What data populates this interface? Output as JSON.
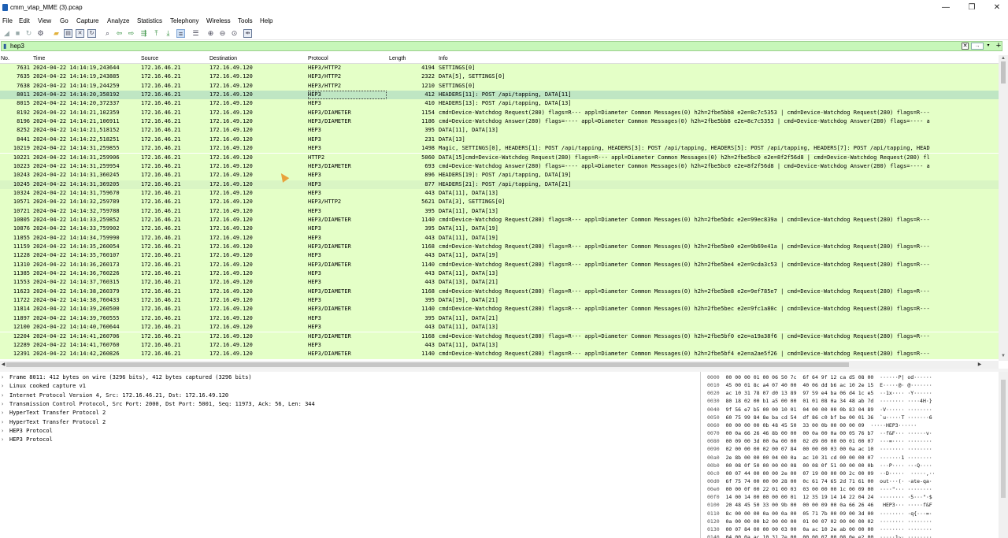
{
  "window": {
    "title": "cmm_vtap_MME (3).pcap",
    "minimize_label": "—",
    "maximize_label": "❐",
    "close_label": "✕"
  },
  "menu": [
    "File",
    "Edit",
    "View",
    "Go",
    "Capture",
    "Analyze",
    "Statistics",
    "Telephony",
    "Wireless",
    "Tools",
    "Help"
  ],
  "filter": {
    "value": "hep3",
    "clear_icon": "✕",
    "apply_icon": "→",
    "dropdown_icon": "▾",
    "add_icon": "+"
  },
  "columns": {
    "no": "No.",
    "time": "Time",
    "source": "Source",
    "destination": "Destination",
    "protocol": "Protocol",
    "length": "Length",
    "info": "Info"
  },
  "packets": [
    {
      "no": "7631",
      "time": "2024-04-22 14:14:19,243644",
      "src": "172.16.46.21",
      "dst": "172.16.49.120",
      "proto": "HEP3/HTTP2",
      "len": "4194",
      "info": "SETTINGS[0]"
    },
    {
      "no": "7635",
      "time": "2024-04-22 14:14:19,243885",
      "src": "172.16.46.21",
      "dst": "172.16.49.120",
      "proto": "HEP3/HTTP2",
      "len": "2322",
      "info": "DATA[5], SETTINGS[0]"
    },
    {
      "no": "7638",
      "time": "2024-04-22 14:14:19,244259",
      "src": "172.16.46.21",
      "dst": "172.16.49.120",
      "proto": "HEP3/HTTP2",
      "len": "1210",
      "info": "SETTINGS[0]"
    },
    {
      "no": "8011",
      "time": "2024-04-22 14:14:20,358192",
      "src": "172.16.46.21",
      "dst": "172.16.49.120",
      "proto": "HEP3",
      "len": "412",
      "info": "HEADERS[11]: POST /api/tapping, DATA[11]"
    },
    {
      "no": "8015",
      "time": "2024-04-22 14:14:20,372337",
      "src": "172.16.46.21",
      "dst": "172.16.49.120",
      "proto": "HEP3",
      "len": "410",
      "info": "HEADERS[13]: POST /api/tapping, DATA[13]"
    },
    {
      "no": "8192",
      "time": "2024-04-22 14:14:21,102359",
      "src": "172.16.46.21",
      "dst": "172.16.49.120",
      "proto": "HEP3/DIAMETER",
      "len": "1154",
      "info": "cmd=Device-Watchdog Request(280) flags=R--- appl=Diameter Common Messages(0) h2h=2fbe5bb8 e2e=8c7c5353 | cmd=Device-Watchdog Request(280) flags=R---"
    },
    {
      "no": "8196",
      "time": "2024-04-22 14:14:21,106911",
      "src": "172.16.46.21",
      "dst": "172.16.49.120",
      "proto": "HEP3/DIAMETER",
      "len": "1186",
      "info": "cmd=Device-Watchdog Answer(280) flags=---- appl=Diameter Common Messages(0) h2h=2fbe5bb8 e2e=8c7c5353 | cmd=Device-Watchdog Answer(280) flags=---- a"
    },
    {
      "no": "8252",
      "time": "2024-04-22 14:14:21,518152",
      "src": "172.16.46.21",
      "dst": "172.16.49.120",
      "proto": "HEP3",
      "len": "395",
      "info": "DATA[11], DATA[13]"
    },
    {
      "no": "8441",
      "time": "2024-04-22 14:14:22,518251",
      "src": "172.16.46.21",
      "dst": "172.16.49.120",
      "proto": "HEP3",
      "len": "231",
      "info": "DATA[13]"
    },
    {
      "no": "10219",
      "time": "2024-04-22 14:14:31,259855",
      "src": "172.16.46.21",
      "dst": "172.16.49.120",
      "proto": "HEP3",
      "len": "1498",
      "info": "Magic, SETTINGS[0], HEADERS[1]: POST /api/tapping, HEADERS[3]: POST /api/tapping, HEADERS[5]: POST /api/tapping, HEADERS[7]: POST /api/tapping, HEAD"
    },
    {
      "no": "10221",
      "time": "2024-04-22 14:14:31,259906",
      "src": "172.16.46.21",
      "dst": "172.16.49.120",
      "proto": "HTTP2",
      "len": "5060",
      "info": "DATA[15]cmd=Device-Watchdog Request(280) flags=R--- appl=Diameter Common Messages(0) h2h=2fbe5bc0 e2e=8f2f56d8 | cmd=Device-Watchdog Request(280) fl"
    },
    {
      "no": "10223",
      "time": "2024-04-22 14:14:31,259954",
      "src": "172.16.46.21",
      "dst": "172.16.49.120",
      "proto": "HEP3/DIAMETER",
      "len": "693",
      "info": "cmd=Device-Watchdog Answer(280) flags=---- appl=Diameter Common Messages(0) h2h=2fbe5bc0 e2e=8f2f56d8 | cmd=Device-Watchdog Answer(280) flags=---- a"
    },
    {
      "no": "10243",
      "time": "2024-04-22 14:14:31,360245",
      "src": "172.16.46.21",
      "dst": "172.16.49.120",
      "proto": "HEP3",
      "len": "896",
      "info": "HEADERS[19]: POST /api/tapping, DATA[19]"
    },
    {
      "no": "10245",
      "time": "2024-04-22 14:14:31,369205",
      "src": "172.16.46.21",
      "dst": "172.16.49.120",
      "proto": "HEP3",
      "len": "877",
      "info": "HEADERS[21]: POST /api/tapping, DATA[21]"
    },
    {
      "no": "10324",
      "time": "2024-04-22 14:14:31,759670",
      "src": "172.16.46.21",
      "dst": "172.16.49.120",
      "proto": "HEP3",
      "len": "443",
      "info": "DATA[11], DATA[13]"
    },
    {
      "no": "10571",
      "time": "2024-04-22 14:14:32,259789",
      "src": "172.16.46.21",
      "dst": "172.16.49.120",
      "proto": "HEP3/HTTP2",
      "len": "5621",
      "info": "DATA[3], SETTINGS[0]"
    },
    {
      "no": "10721",
      "time": "2024-04-22 14:14:32,759788",
      "src": "172.16.46.21",
      "dst": "172.16.49.120",
      "proto": "HEP3",
      "len": "395",
      "info": "DATA[11], DATA[13]"
    },
    {
      "no": "10805",
      "time": "2024-04-22 14:14:33,259852",
      "src": "172.16.46.21",
      "dst": "172.16.49.120",
      "proto": "HEP3/DIAMETER",
      "len": "1140",
      "info": "cmd=Device-Watchdog Request(280) flags=R--- appl=Diameter Common Messages(0) h2h=2fbe5bdc e2e=99ec839a | cmd=Device-Watchdog Request(280) flags=R---"
    },
    {
      "no": "10876",
      "time": "2024-04-22 14:14:33,759902",
      "src": "172.16.46.21",
      "dst": "172.16.49.120",
      "proto": "HEP3",
      "len": "395",
      "info": "DATA[11], DATA[19]"
    },
    {
      "no": "11055",
      "time": "2024-04-22 14:14:34,759990",
      "src": "172.16.46.21",
      "dst": "172.16.49.120",
      "proto": "HEP3",
      "len": "443",
      "info": "DATA[11], DATA[19]"
    },
    {
      "no": "11159",
      "time": "2024-04-22 14:14:35,260054",
      "src": "172.16.46.21",
      "dst": "172.16.49.120",
      "proto": "HEP3/DIAMETER",
      "len": "1168",
      "info": "cmd=Device-Watchdog Request(280) flags=R--- appl=Diameter Common Messages(0) h2h=2fbe5be0 e2e=9b69e41a | cmd=Device-Watchdog Request(280) flags=R---"
    },
    {
      "no": "11228",
      "time": "2024-04-22 14:14:35,760107",
      "src": "172.16.46.21",
      "dst": "172.16.49.120",
      "proto": "HEP3",
      "len": "443",
      "info": "DATA[11], DATA[19]"
    },
    {
      "no": "11310",
      "time": "2024-04-22 14:14:36,260173",
      "src": "172.16.46.21",
      "dst": "172.16.49.120",
      "proto": "HEP3/DIAMETER",
      "len": "1140",
      "info": "cmd=Device-Watchdog Request(280) flags=R--- appl=Diameter Common Messages(0) h2h=2fbe5be4 e2e=9cda3c53 | cmd=Device-Watchdog Request(280) flags=R---"
    },
    {
      "no": "11385",
      "time": "2024-04-22 14:14:36,760226",
      "src": "172.16.46.21",
      "dst": "172.16.49.120",
      "proto": "HEP3",
      "len": "443",
      "info": "DATA[11], DATA[13]"
    },
    {
      "no": "11553",
      "time": "2024-04-22 14:14:37,760315",
      "src": "172.16.46.21",
      "dst": "172.16.49.120",
      "proto": "HEP3",
      "len": "443",
      "info": "DATA[13], DATA[21]"
    },
    {
      "no": "11623",
      "time": "2024-04-22 14:14:38,260379",
      "src": "172.16.46.21",
      "dst": "172.16.49.120",
      "proto": "HEP3/DIAMETER",
      "len": "1168",
      "info": "cmd=Device-Watchdog Request(280) flags=R--- appl=Diameter Common Messages(0) h2h=2fbe5be8 e2e=9ef785e7 | cmd=Device-Watchdog Request(280) flags=R---"
    },
    {
      "no": "11722",
      "time": "2024-04-22 14:14:38,760433",
      "src": "172.16.46.21",
      "dst": "172.16.49.120",
      "proto": "HEP3",
      "len": "395",
      "info": "DATA[19], DATA[21]"
    },
    {
      "no": "11814",
      "time": "2024-04-22 14:14:39,260500",
      "src": "172.16.46.21",
      "dst": "172.16.49.120",
      "proto": "HEP3/DIAMETER",
      "len": "1140",
      "info": "cmd=Device-Watchdog Request(280) flags=R--- appl=Diameter Common Messages(0) h2h=2fbe5bec e2e=9fc1a80c | cmd=Device-Watchdog Request(280) flags=R---"
    },
    {
      "no": "11897",
      "time": "2024-04-22 14:14:39,760555",
      "src": "172.16.46.21",
      "dst": "172.16.49.120",
      "proto": "HEP3",
      "len": "395",
      "info": "DATA[11], DATA[21]"
    },
    {
      "no": "12100",
      "time": "2024-04-22 14:14:40,760644",
      "src": "172.16.46.21",
      "dst": "172.16.49.120",
      "proto": "HEP3",
      "len": "443",
      "info": "DATA[11], DATA[13]"
    },
    {
      "no": "12204",
      "time": "2024-04-22 14:14:41,260706",
      "src": "172.16.46.21",
      "dst": "172.16.49.120",
      "proto": "HEP3/DIAMETER",
      "len": "1168",
      "info": "cmd=Device-Watchdog Request(280) flags=R--- appl=Diameter Common Messages(0) h2h=2fbe5bf0 e2e=a19a38f6 | cmd=Device-Watchdog Request(280) flags=R---"
    },
    {
      "no": "12289",
      "time": "2024-04-22 14:14:41,760760",
      "src": "172.16.46.21",
      "dst": "172.16.49.120",
      "proto": "HEP3",
      "len": "443",
      "info": "DATA[11], DATA[13]"
    },
    {
      "no": "12391",
      "time": "2024-04-22 14:14:42,260826",
      "src": "172.16.46.21",
      "dst": "172.16.49.120",
      "proto": "HEP3/DIAMETER",
      "len": "1140",
      "info": "cmd=Device-Watchdog Request(280) flags=R--- appl=Diameter Common Messages(0) h2h=2fbe5bf4 e2e=a2ae5f26 | cmd=Device-Watchdog Request(280) flags=R---"
    }
  ],
  "selected_packet_no": "8011",
  "details": [
    "Frame 8011: 412 bytes on wire (3296 bits), 412 bytes captured (3296 bits)",
    "Linux cooked capture v1",
    "Internet Protocol Version 4, Src: 172.16.46.21, Dst: 172.16.49.120",
    "Transmission Control Protocol, Src Port: 2000, Dst Port: 5001, Seq: 11973, Ack: 56, Len: 344",
    "HyperText Transfer Protocol 2",
    "HyperText Transfer Protocol 2",
    "HEP3 Protocol",
    "HEP3 Protocol"
  ],
  "bytes": [
    {
      "off": "0000",
      "hex": "00 00 00 01 00 06 50 7c  6f 64 9f 12 ca d5 08 00",
      "ascii": "······P| od······"
    },
    {
      "off": "0010",
      "hex": "45 00 01 8c a4 07 40 00  40 06 dd b6 ac 10 2e 15",
      "ascii": "E·····@· @·······"
    },
    {
      "off": "0020",
      "hex": "ac 10 31 78 07 d0 13 89  97 59 e4 ba 06 d4 1c e5",
      "ascii": "··1x···· ·Y······"
    },
    {
      "off": "0030",
      "hex": "80 18 02 00 b1 a5 00 00  01 01 08 0a 34 48 ab 7d",
      "ascii": "········ ····4H·}"
    },
    {
      "off": "0040",
      "hex": "9f 56 e7 b5 00 00 10 01  04 00 00 00 0b 83 04 89",
      "ascii": "·V······ ········"
    },
    {
      "off": "0050",
      "hex": "60 75 99 84 8e ba cd 54  df 86 c0 bf be 00 01 36",
      "ascii": "`u·····T ·······6"
    },
    {
      "off": "0060",
      "hex": "00 00 00 00 0b 48 45 50  33 00 0b 00 00 00 09",
      "ascii": "·····HEP3······"
    },
    {
      "off": "0070",
      "hex": "00 0a 66 26 46 8b 00 00  00 0a 00 0a 00 05 76 b7",
      "ascii": "··f&F··· ······v·"
    },
    {
      "off": "0080",
      "hex": "00 09 00 3d 00 0a 00 00  02 d9 00 00 00 01 00 07",
      "ascii": "···=···· ········"
    },
    {
      "off": "0090",
      "hex": "02 00 00 00 02 00 07 84  00 00 00 03 00 0a ac 10",
      "ascii": "········ ········"
    },
    {
      "off": "00a0",
      "hex": "2e 8b 00 00 00 04 00 0a  ac 10 31 cd 00 00 00 07",
      "ascii": "·······1 ········"
    },
    {
      "off": "00b0",
      "hex": "00 08 0f 50 00 00 00 08  00 08 0f 51 00 00 00 0b",
      "ascii": "···P···· ···Q····"
    },
    {
      "off": "00c0",
      "hex": "00 07 44 00 00 00 2e 00  07 19 00 00 00 2c 00 09",
      "ascii": "··D·····  ·····,··"
    },
    {
      "off": "00d0",
      "hex": "6f 75 74 00 00 00 28 00  0c 61 74 65 2d 71 61 00",
      "ascii": "out···(· ·ate-qa·"
    },
    {
      "off": "00e0",
      "hex": "00 00 0f 00 22 01 00 03  03 00 00 00 1c 00 09 00",
      "ascii": "····\"··· ········"
    },
    {
      "off": "00f0",
      "hex": "14 00 14 00 00 00 00 01  12 35 19 14 14 22 04 24",
      "ascii": "········ ·5···\"·$"
    },
    {
      "off": "0100",
      "hex": "20 48 45 50 33 00 9b 00  00 00 09 00 0a 66 26 46",
      "ascii": " HEP3··· ·····f&F"
    },
    {
      "off": "0110",
      "hex": "8c 00 00 00 0a 00 0a 00  05 71 7b 00 09 00 3d 00",
      "ascii": "········ ·q{···=·"
    },
    {
      "off": "0120",
      "hex": "0a 00 00 00 b2 00 00 00  01 00 07 02 00 00 00 02",
      "ascii": "········ ········"
    },
    {
      "off": "0130",
      "hex": "00 07 84 00 00 00 03 00  0a ac 10 2e ab 00 00 00",
      "ascii": "········ ········"
    },
    {
      "off": "0140",
      "hex": "04 00 0a ac 10 31 7e 00  00 00 07 00 08 0e e2 00",
      "ascii": "·····1~· ········"
    }
  ],
  "toolbar_icons": [
    "shark-fin-start-icon",
    "stop-icon",
    "restart-icon",
    "capture-options-icon",
    "open-icon",
    "save-icon",
    "close-file-icon",
    "reload-icon",
    "find-icon",
    "back-icon",
    "forward-icon",
    "go-to-packet-icon",
    "first-packet-icon",
    "last-packet-icon",
    "autoscroll-icon",
    "colorize-icon",
    "zoom-in-icon",
    "zoom-out-icon",
    "zoom-normal-icon",
    "resize-columns-icon"
  ],
  "colors": {
    "row_bg": "#e4ffc7",
    "row_selected": "#bfe6c3",
    "filter_valid": "#c7f7b9"
  }
}
